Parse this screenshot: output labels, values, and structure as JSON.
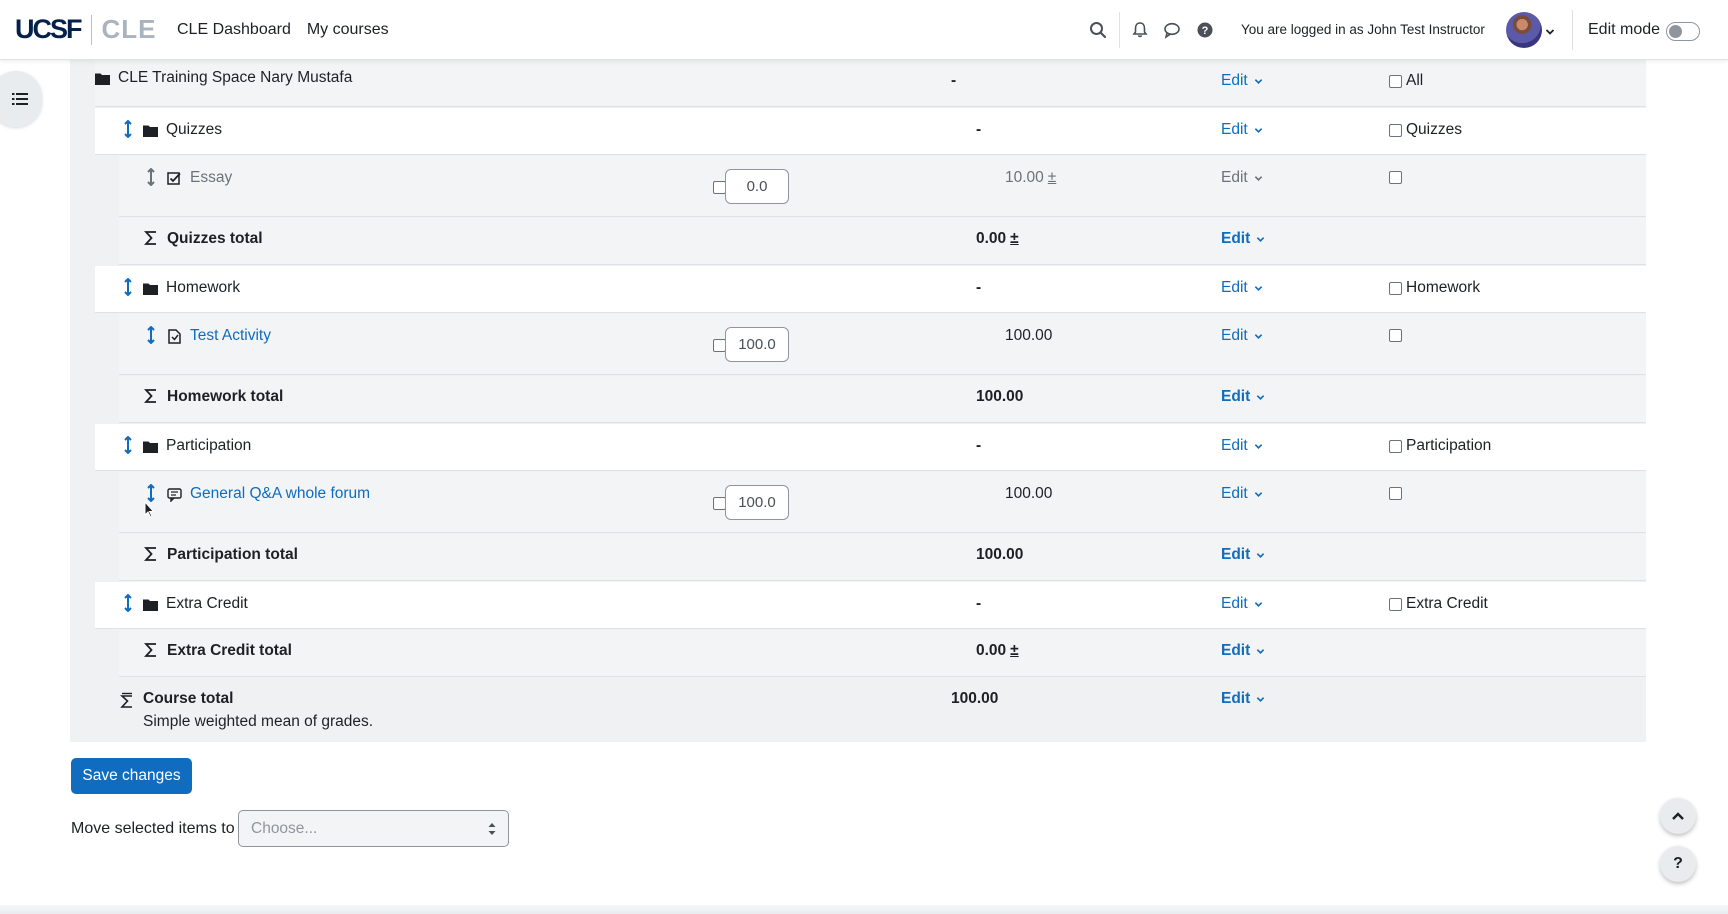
{
  "navbar": {
    "logo_ucsf": "UCSF",
    "logo_cle": "CLE",
    "links": [
      "CLE Dashboard",
      "My courses"
    ],
    "login_text": "You are logged in as John Test Instructor",
    "edit_mode_label": "Edit mode",
    "edit_mode_on": false
  },
  "grade_setup": {
    "category": {
      "name": "CLE Training Space Nary Mustafa",
      "total": "-",
      "edit_label": "Edit",
      "select_label": "All"
    },
    "rows": [
      {
        "type": "category",
        "name": "Quizzes",
        "total": "-",
        "edit": "Edit",
        "select": "Quizzes"
      },
      {
        "type": "item",
        "name": "Essay",
        "icon": "assignment-check-icon",
        "weight": "0.0",
        "max_grade": "10.00",
        "max_grade_suffix": "±",
        "edit": "Edit",
        "hidden": true
      },
      {
        "type": "total",
        "name": "Quizzes total",
        "total": "0.00",
        "total_suffix": "±",
        "edit": "Edit"
      },
      {
        "type": "category",
        "name": "Homework",
        "total": "-",
        "edit": "Edit",
        "select": "Homework"
      },
      {
        "type": "item",
        "name": "Test Activity",
        "icon": "assignment-icon",
        "weight": "100.0",
        "max_grade": "100.00",
        "edit": "Edit"
      },
      {
        "type": "total",
        "name": "Homework total",
        "total": "100.00",
        "edit": "Edit"
      },
      {
        "type": "category",
        "name": "Participation",
        "total": "-",
        "edit": "Edit",
        "select": "Participation"
      },
      {
        "type": "item",
        "name": "General Q&A whole forum",
        "icon": "forum-icon",
        "weight": "100.0",
        "max_grade": "100.00",
        "edit": "Edit"
      },
      {
        "type": "total",
        "name": "Participation total",
        "total": "100.00",
        "edit": "Edit"
      },
      {
        "type": "category",
        "name": "Extra Credit",
        "total": "-",
        "edit": "Edit",
        "select": "Extra Credit"
      },
      {
        "type": "total",
        "name": "Extra Credit total",
        "total": "0.00",
        "total_suffix": "±",
        "edit": "Edit"
      }
    ],
    "course_total": {
      "name": "Course total",
      "subtitle": "Simple weighted mean of grades.",
      "total": "100.00",
      "edit": "Edit"
    }
  },
  "actions": {
    "save_label": "Save changes",
    "move_label": "Move selected items to",
    "move_placeholder": "Choose..."
  },
  "fab": {
    "scroll_top": "^",
    "help": "?"
  },
  "colors": {
    "link": "#0f6cbf",
    "primary_button": "#0f6cbf",
    "muted_text": "#6a737b"
  }
}
